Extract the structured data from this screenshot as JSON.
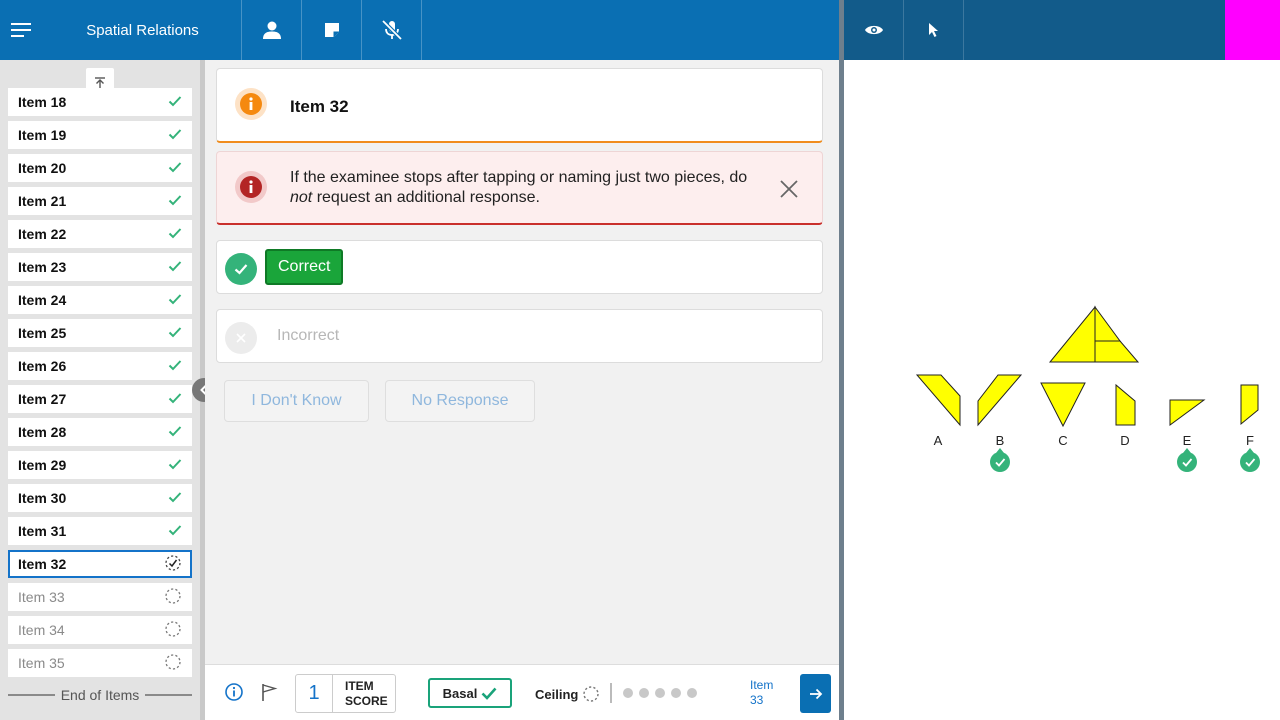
{
  "app": {
    "title": "Spatial Relations"
  },
  "sidebar": {
    "items": [
      {
        "label": "Item 18",
        "status": "done"
      },
      {
        "label": "Item 19",
        "status": "done"
      },
      {
        "label": "Item 20",
        "status": "done"
      },
      {
        "label": "Item 21",
        "status": "done"
      },
      {
        "label": "Item 22",
        "status": "done"
      },
      {
        "label": "Item 23",
        "status": "done"
      },
      {
        "label": "Item 24",
        "status": "done"
      },
      {
        "label": "Item 25",
        "status": "done"
      },
      {
        "label": "Item 26",
        "status": "done"
      },
      {
        "label": "Item 27",
        "status": "done"
      },
      {
        "label": "Item 28",
        "status": "done"
      },
      {
        "label": "Item 29",
        "status": "done"
      },
      {
        "label": "Item 30",
        "status": "done"
      },
      {
        "label": "Item 31",
        "status": "done"
      },
      {
        "label": "Item 32",
        "status": "current"
      },
      {
        "label": "Item 33",
        "status": "pending"
      },
      {
        "label": "Item 34",
        "status": "pending"
      },
      {
        "label": "Item 35",
        "status": "pending"
      }
    ],
    "end_label": "End of Items"
  },
  "main": {
    "item_title": "Item 32",
    "alert": {
      "before": "If the examinee stops after tapping or naming just two pieces, do ",
      "emphasis": "not",
      "after": " request an additional response."
    },
    "correct_label": "Correct",
    "incorrect_label": "Incorrect",
    "dont_know_label": "I Don't Know",
    "no_response_label": "No Response"
  },
  "footer": {
    "item_score": "1",
    "item_score_label_1": "ITEM",
    "item_score_label_2": "SCORE",
    "basal_label": "Basal",
    "ceiling_label": "Ceiling",
    "next_label_1": "Item",
    "next_label_2": "33"
  },
  "stimulus": {
    "choices": [
      "A",
      "B",
      "C",
      "D",
      "E",
      "F"
    ],
    "selected": [
      "B",
      "E",
      "F"
    ]
  },
  "colors": {
    "header": "#0a6fb3",
    "header_right": "#125b8a",
    "accent_magenta": "#ff00ff",
    "check_green": "#34b37a",
    "correct_green": "#1aa53a",
    "alert_red": "#c9302c",
    "info_orange": "#f5890f",
    "shape_yellow": "#ffff00"
  }
}
